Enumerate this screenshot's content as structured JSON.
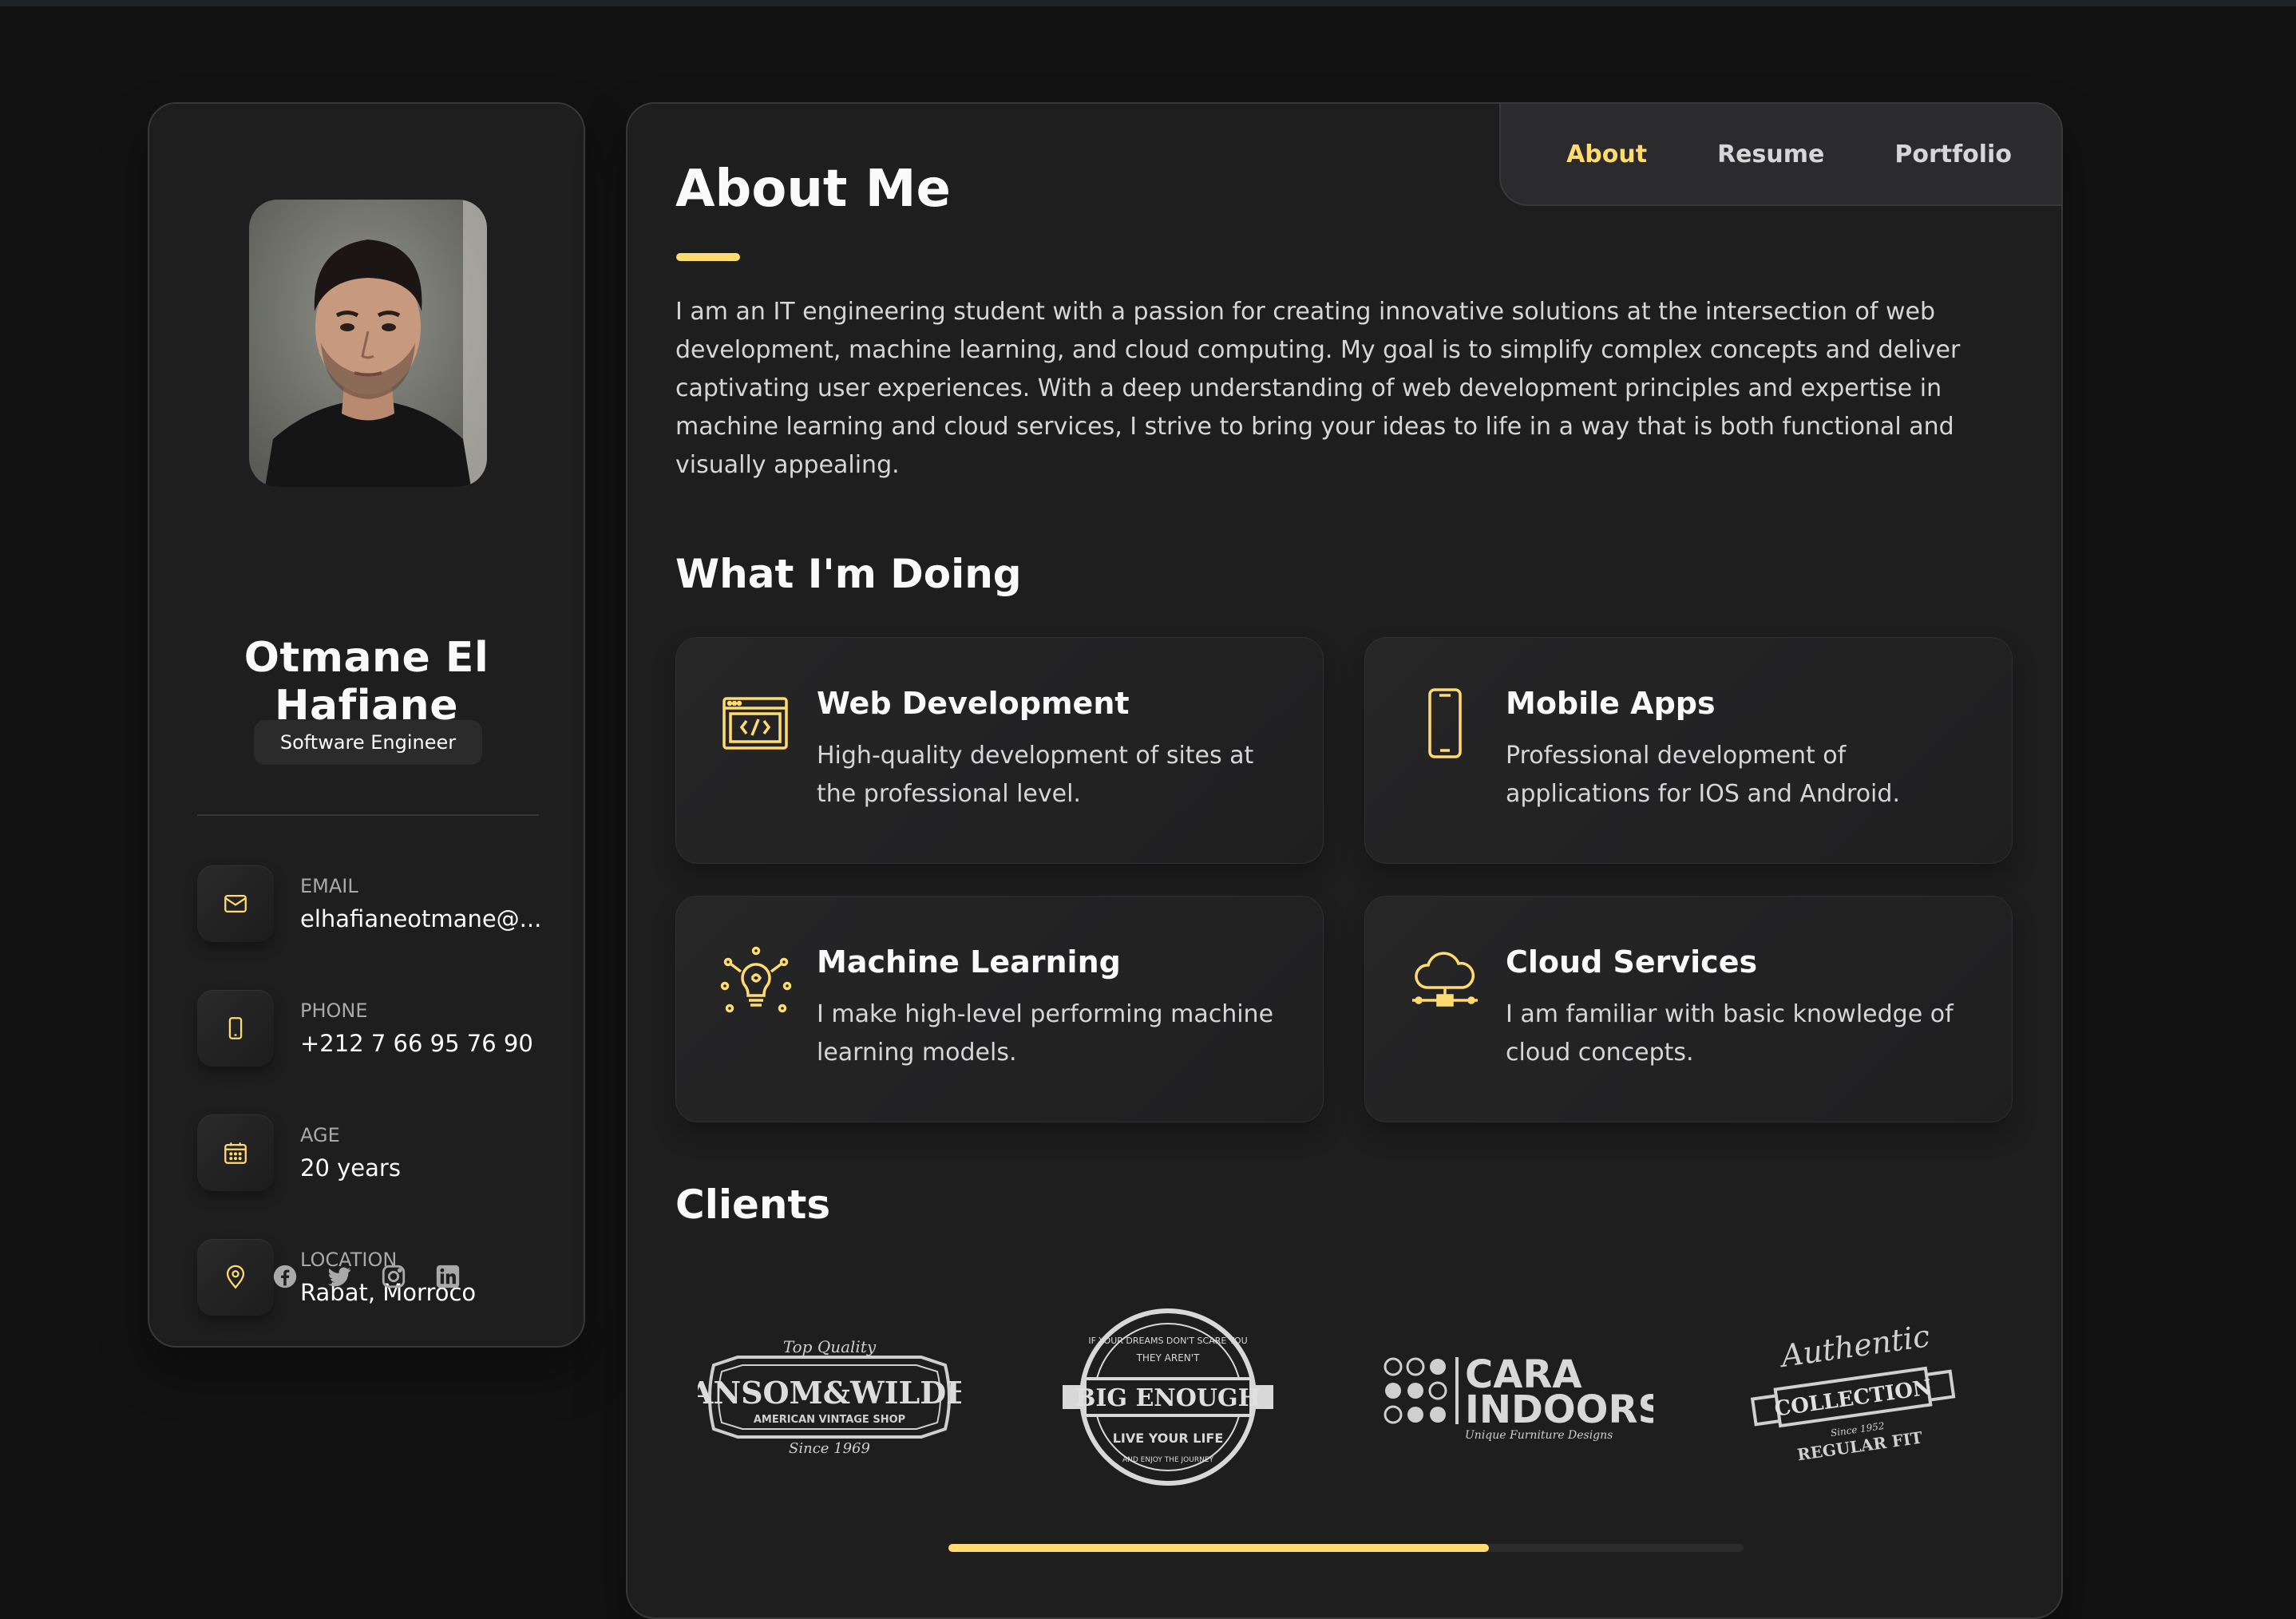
{
  "profile": {
    "name": "Otmane El Hafiane",
    "title": "Software Engineer",
    "avatar_icon": "avatar-photo"
  },
  "contacts": [
    {
      "label": "EMAIL",
      "value": "elhafianeotmane@...",
      "icon": "mail-icon"
    },
    {
      "label": "PHONE",
      "value": "+212 7 66 95 76 90",
      "icon": "phone-icon"
    },
    {
      "label": "AGE",
      "value": "20 years",
      "icon": "calendar-icon"
    },
    {
      "label": "LOCATION",
      "value": "Rabat, Morroco",
      "icon": "location-pin-icon"
    }
  ],
  "socials": [
    "facebook-icon",
    "twitter-icon",
    "instagram-icon",
    "linkedin-icon"
  ],
  "navbar": {
    "items": [
      "About",
      "Resume",
      "Portfolio"
    ],
    "active": "About"
  },
  "about": {
    "title": "About Me",
    "text": "I am an IT engineering student with a passion for creating innovative solutions at the intersection of web development, machine learning, and cloud computing. My goal is to simplify complex concepts and deliver captivating user experiences. With a deep understanding of web development principles and expertise in machine learning and cloud services, I strive to bring your ideas to life in a way that is both functional and visually appealing."
  },
  "doing": {
    "title": "What I'm Doing",
    "services": [
      {
        "title": "Web Development",
        "desc": "High-quality development of sites at the professional level.",
        "icon": "web-code-icon"
      },
      {
        "title": "Mobile Apps",
        "desc": "Professional development of applications for IOS and Android.",
        "icon": "mobile-icon"
      },
      {
        "title": "Machine Learning",
        "desc": "I make high-level performing machine learning models.",
        "icon": "lightbulb-brain-icon"
      },
      {
        "title": "Cloud Services",
        "desc": "I am familiar with basic knowledge of cloud concepts.",
        "icon": "cloud-network-icon"
      }
    ]
  },
  "clients": {
    "title": "Clients",
    "logos": [
      {
        "name": "ransom-wilder-logo",
        "text": "RANSOM&WILDER",
        "top": "Top Quality",
        "bottom": "AMERICAN VINTAGE SHOP",
        "since": "Since 1969"
      },
      {
        "name": "big-enough-logo",
        "text": "BIG ENOUGH",
        "top": "IF YOUR DREAMS DON'T SCARE YOU",
        "mid": "THEY AREN'T",
        "sub": "LIVE YOUR LIFE",
        "bottom": "AND ENJOY THE JOURNEY"
      },
      {
        "name": "cara-indoors-logo",
        "text": "CARA",
        "text2": "INDOORS",
        "sub": "Unique Furniture Designs"
      },
      {
        "name": "authentic-collection-logo",
        "text": "COLLECTION",
        "top": "Authentic",
        "since": "Since 1952",
        "bottom": "REGULAR FIT"
      }
    ],
    "scroll_progress": 0.68
  },
  "colors": {
    "accent": "#ffdb70",
    "card_bg": "#1e1e1f",
    "page_bg": "#121212"
  }
}
